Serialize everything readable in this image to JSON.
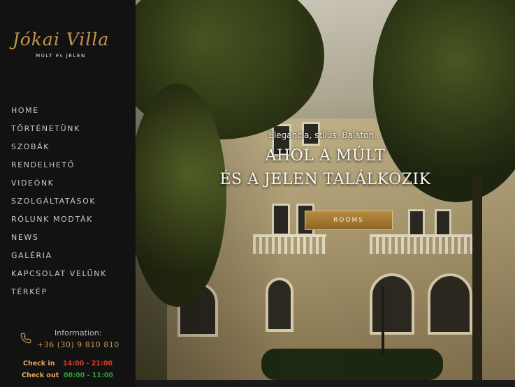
{
  "logo": {
    "script": "Jókai Villa",
    "subtitle": "MÚLT és JELEN"
  },
  "nav": [
    {
      "label": "HOME"
    },
    {
      "label": "TÖRTÉNETÜNK"
    },
    {
      "label": "SZOBÁK"
    },
    {
      "label": "RENDELHETŐ"
    },
    {
      "label": "VIDEÓNK"
    },
    {
      "label": "SZOLGÁLTATÁSOK"
    },
    {
      "label": "RÓLUNK MODTÁK"
    },
    {
      "label": "NEWS"
    },
    {
      "label": "GALÉRIA"
    },
    {
      "label": "KAPCSOLAT VELÜNK"
    },
    {
      "label": "TÉRKÉP"
    }
  ],
  "info": {
    "title": "Information:",
    "phone": "+36 (30) 9 810 810",
    "icon": "phone-icon"
  },
  "checkin": {
    "label": "Check in",
    "time": "14:00 - 21:00"
  },
  "checkout": {
    "label": "Check out",
    "time": "08:00 - 11:00"
  },
  "hero": {
    "tagline": "Elegancia, stílus, Balaton...",
    "heading_line1": "AHOL A MÚLT",
    "heading_line2": "ÉS A JELEN TALÁLKOZIK",
    "button": "ROOMS"
  },
  "colors": {
    "accent": "#c7934f",
    "checkin": "#d6412a",
    "checkout": "#2f9e3a",
    "sidebar": "#121212"
  }
}
